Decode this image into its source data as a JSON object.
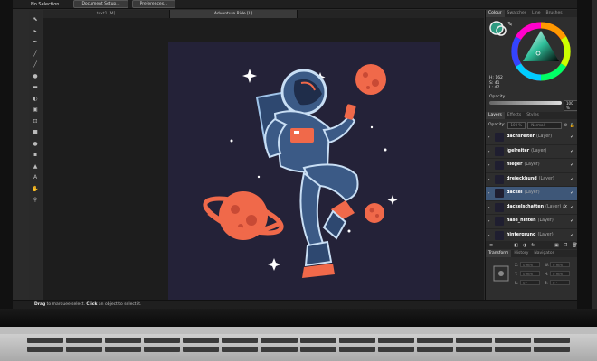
{
  "context_toolbar": {
    "selection_status": "No Selection",
    "document_setup_label": "Document Setup...",
    "preferences_label": "Preferences..."
  },
  "tabs": [
    {
      "label": "text1 [M]",
      "active": false
    },
    {
      "label": "Adventure Ride [L]",
      "active": true
    }
  ],
  "tools": [
    {
      "icon": "move-tool-icon",
      "glyph": "⬉"
    },
    {
      "icon": "node-tool-icon",
      "glyph": "▸"
    },
    {
      "icon": "pen-tool-icon",
      "glyph": "✒"
    },
    {
      "icon": "pencil-tool-icon",
      "glyph": "╱"
    },
    {
      "icon": "brush-tool-icon",
      "glyph": "╱"
    },
    {
      "icon": "fill-tool-icon",
      "glyph": "●"
    },
    {
      "icon": "gradient-tool-icon",
      "glyph": "▬"
    },
    {
      "icon": "transparency-tool-icon",
      "glyph": "◐"
    },
    {
      "icon": "place-image-tool-icon",
      "glyph": "▣"
    },
    {
      "icon": "crop-tool-icon",
      "glyph": "⊡"
    },
    {
      "icon": "rectangle-tool-icon",
      "glyph": "■"
    },
    {
      "icon": "ellipse-tool-icon",
      "glyph": "●"
    },
    {
      "icon": "rounded-rect-tool-icon",
      "glyph": "▪"
    },
    {
      "icon": "triangle-tool-icon",
      "glyph": "▲"
    },
    {
      "icon": "text-tool-icon",
      "glyph": "A"
    },
    {
      "icon": "hand-tool-icon",
      "glyph": "✋"
    },
    {
      "icon": "zoom-tool-icon",
      "glyph": "⚲"
    }
  ],
  "status": {
    "drag_word": "Drag",
    "drag_text": " to marquee select. ",
    "click_word": "Click",
    "click_text": " an object to select it."
  },
  "color_panel": {
    "tabs": [
      {
        "label": "Colour",
        "active": true
      },
      {
        "label": "Swatches",
        "active": false
      },
      {
        "label": "Line",
        "active": false
      },
      {
        "label": "Brushes",
        "active": false
      }
    ],
    "h": "H: 162",
    "s": "S: 41",
    "l": "L: 47",
    "opacity_label": "Opacity",
    "opacity_value": "100 %",
    "fill_color": "#2f9a80"
  },
  "layers_panel": {
    "tabs": [
      {
        "label": "Layers",
        "active": true
      },
      {
        "label": "Effects",
        "active": false
      },
      {
        "label": "Styles",
        "active": false
      }
    ],
    "opacity_label": "Opacity:",
    "opacity_value": "100 %",
    "blend_mode": "Normal",
    "layers": [
      {
        "name": "dachsreiter",
        "type": "(Layer)",
        "selected": false,
        "fx": false
      },
      {
        "name": "igelreiter",
        "type": "(Layer)",
        "selected": false,
        "fx": false
      },
      {
        "name": "flieger",
        "type": "(Layer)",
        "selected": false,
        "fx": false
      },
      {
        "name": "dreieckhund",
        "type": "(Layer)",
        "selected": false,
        "fx": false
      },
      {
        "name": "dackel",
        "type": "(Layer)",
        "selected": true,
        "fx": false
      },
      {
        "name": "dackelschatten",
        "type": "(Layer)",
        "selected": false,
        "fx": true
      },
      {
        "name": "hase_hinten",
        "type": "(Layer)",
        "selected": false,
        "fx": false
      },
      {
        "name": "hintergrund",
        "type": "(Layer)",
        "selected": false,
        "fx": false
      }
    ]
  },
  "transform_panel": {
    "tabs": [
      {
        "label": "Transform",
        "active": true
      },
      {
        "label": "History",
        "active": false
      },
      {
        "label": "Navigator",
        "active": false
      }
    ],
    "x_label": "X:",
    "x_value": "0 mm",
    "y_label": "Y:",
    "y_value": "0 mm",
    "w_label": "W:",
    "w_value": "0 mm",
    "h_label": "H:",
    "h_value": "0 mm",
    "r_label": "R:",
    "r_value": "0 °",
    "s_label": "S:",
    "s_value": "0 °"
  },
  "colors": {
    "accent_orange": "#f0694a",
    "artboard_bg": "#242238",
    "astronaut_blue": "#3b5a86",
    "selected_layer": "#3e5778"
  }
}
